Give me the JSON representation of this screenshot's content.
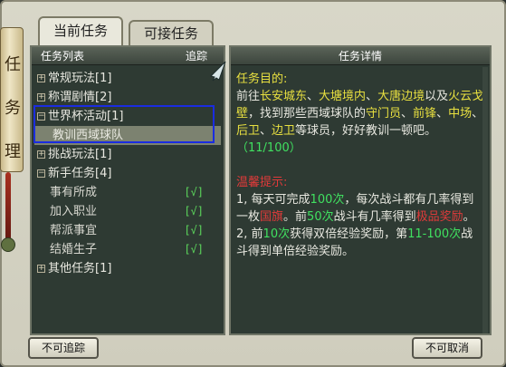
{
  "tabs": [
    {
      "label": "当前任务",
      "active": true
    },
    {
      "label": "可接任务",
      "active": false
    }
  ],
  "scroll_text": [
    "任",
    "务",
    "理"
  ],
  "left_panel": {
    "header": "任务列表",
    "track_label": "追踪",
    "items": [
      {
        "label": "常规玩法[1]",
        "toggle": "+"
      },
      {
        "label": "称谓剧情[2]",
        "toggle": "+"
      },
      {
        "label": "世界杯活动[1]",
        "toggle": "-"
      },
      {
        "label": "教训西域球队",
        "child": true,
        "selected": true
      },
      {
        "label": "挑战玩法[1]",
        "toggle": "+"
      },
      {
        "label": "新手任务[4]",
        "toggle": "-"
      },
      {
        "label": "事有所成",
        "child": true,
        "check": "[√]"
      },
      {
        "label": "加入职业",
        "child": true,
        "check": "[√]"
      },
      {
        "label": "帮派事宜",
        "child": true,
        "check": "[√]"
      },
      {
        "label": "结婚生子",
        "child": true,
        "check": "[√]"
      },
      {
        "label": "其他任务[1]",
        "toggle": "+"
      }
    ]
  },
  "right_panel": {
    "header": "任务详情",
    "goal_label": "任务目的:",
    "goal_1": "前往",
    "loc_1": "长安城东",
    "sep_1": "、",
    "loc_2": "大塘境内",
    "sep_2": "、",
    "loc_3": "大唐边境",
    "goal_2": "以及",
    "loc_4": "火云戈壁",
    "goal_3": "，找到那些西域球队的",
    "role_1": "守门员",
    "sep_3": "、",
    "role_2": "前锋",
    "sep_4": "、",
    "role_3": "中场",
    "sep_5": "、",
    "role_4": "后卫",
    "sep_6": "、",
    "role_5": "边卫",
    "goal_4": "等球员，好好教训一顿吧。",
    "progress": "（11/100）",
    "tip_label": "温馨提示:",
    "tip_1a": "1, 每天可完成",
    "tip_1b": "100次",
    "tip_1c": "，每次战斗都有几率得到一枚",
    "tip_1d": "国旗",
    "tip_1e": "。前",
    "tip_1f": "50次",
    "tip_1g": "战斗有几率得到",
    "tip_1h": "极品奖励",
    "tip_1i": "。",
    "tip_2a": "2, 前",
    "tip_2b": "10次",
    "tip_2c": "获得双倍经验奖励，第",
    "tip_2d": "11-100次",
    "tip_2e": "战斗得到单倍经验奖励。"
  },
  "buttons": {
    "untrack": "不可追踪",
    "cancel": "不可取消"
  }
}
